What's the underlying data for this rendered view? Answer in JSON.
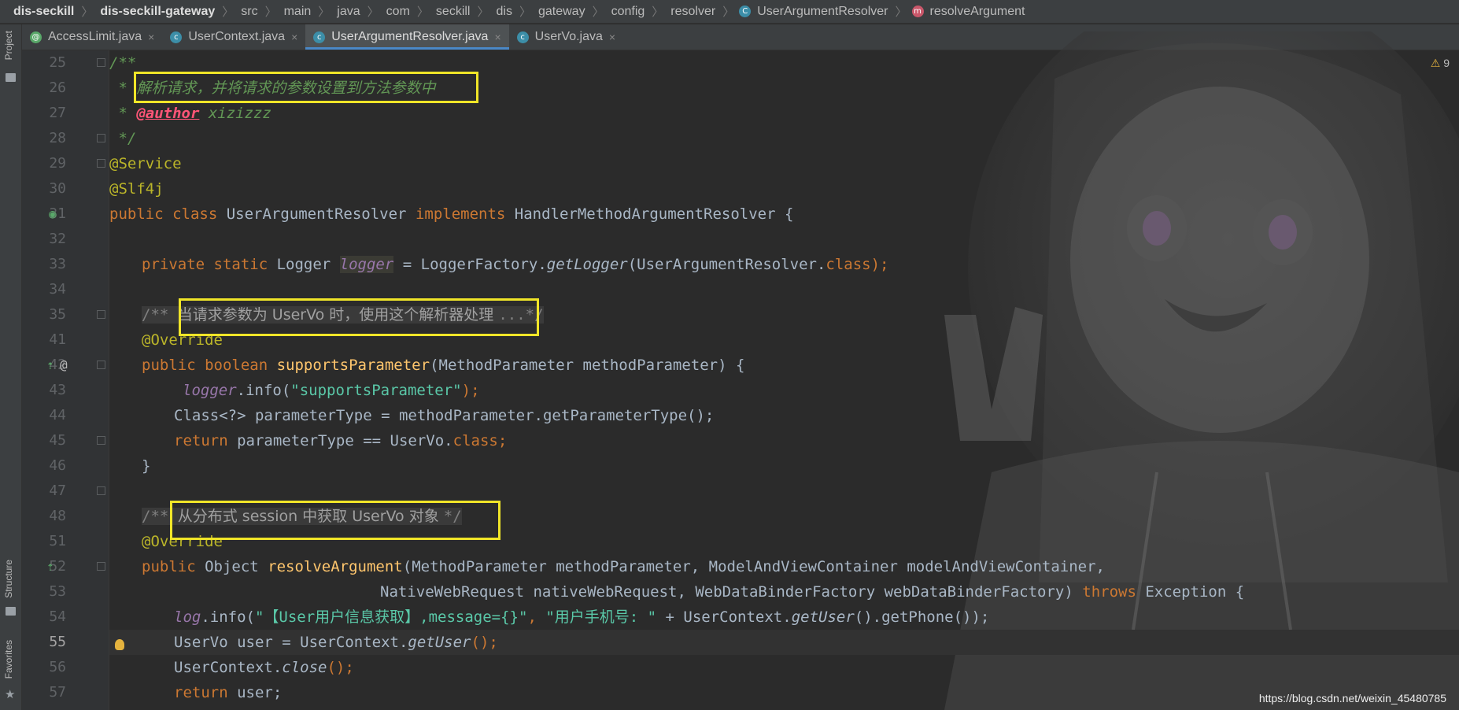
{
  "breadcrumb": {
    "items": [
      "dis-seckill",
      "dis-seckill-gateway",
      "src",
      "main",
      "java",
      "com",
      "seckill",
      "dis",
      "gateway",
      "config",
      "resolver",
      "UserArgumentResolver",
      "resolveArgument"
    ],
    "class_badge": "C",
    "method_badge": "m"
  },
  "tabs": [
    {
      "label": "AccessLimit.java",
      "icon": "annotation-icon",
      "close": "×"
    },
    {
      "label": "UserContext.java",
      "icon": "class-icon",
      "close": "×"
    },
    {
      "label": "UserArgumentResolver.java",
      "icon": "class-icon",
      "close": "×",
      "active": true
    },
    {
      "label": "UserVo.java",
      "icon": "class-icon",
      "close": "×"
    }
  ],
  "toolstrip": {
    "project": "Project",
    "structure": "Structure",
    "favorites": "Favorites"
  },
  "editor": {
    "warning_count": "9",
    "line_numbers": [
      "25",
      "26",
      "27",
      "28",
      "29",
      "30",
      "31",
      "32",
      "33",
      "34",
      "35",
      "41",
      "42",
      "43",
      "44",
      "45",
      "46",
      "47",
      "48",
      "51",
      "52",
      "53",
      "54",
      "55",
      "56",
      "57"
    ],
    "current_line": "55",
    "gutter_at": "@",
    "code": {
      "l25": "/**",
      "l26_star": " * ",
      "l26_text": "解析请求，并将请求的参数设置到方法参数中",
      "l27_star": " * ",
      "l27_tag": "@author",
      "l27_text": " xizizzz",
      "l28": " */",
      "l29": "@Service",
      "l30": "@Slf4j",
      "l31_kw": "public class ",
      "l31_name": "UserArgumentResolver ",
      "l31_impl": "implements ",
      "l31_rest": "HandlerMethodArgumentResolver {",
      "l33_kw": "private static ",
      "l33_type": "Logger ",
      "l33_field": "logger",
      "l33_eq": " = LoggerFactory.",
      "l33_call": "getLogger",
      "l33_arg": "(UserArgumentResolver.",
      "l33_class": "class",
      "l33_end": ");",
      "l35_open": "/** ",
      "l35_text": "当请求参数为 UserVo 时，使用这个解析器处理 ",
      "l35_end": "...*/",
      "l41": "@Override",
      "l42_kw": "public boolean ",
      "l42_fn": "supportsParameter",
      "l42_rest": "(MethodParameter methodParameter) {",
      "l43_field": "logger",
      "l43_mid": ".info(",
      "l43_str": "\"supportsParameter\"",
      "l43_end": ");",
      "l44": "Class<?> parameterType = methodParameter.getParameterType();",
      "l44_semi": ";",
      "l45_kw": "return ",
      "l45_mid": "parameterType == UserVo.",
      "l45_class": "class",
      "l45_end": ";",
      "l46": "}",
      "l48_open": "/** ",
      "l48_text": "从分布式 session 中获取 UserVo 对象 ",
      "l48_end": "*/",
      "l51": "@Override",
      "l52_kw": "public ",
      "l52_type": "Object ",
      "l52_fn": "resolveArgument",
      "l52_rest": "(MethodParameter methodParameter, ModelAndViewContainer modelAndViewContainer,",
      "l53_rest": "NativeWebRequest nativeWebRequest, WebDataBinderFactory webDataBinderFactory) ",
      "l53_kw": "throws ",
      "l53_end": "Exception {",
      "l54_field": "log",
      "l54_mid": ".info(",
      "l54_str": "\"【User用户信息获取】,message={}\"",
      "l54_comma": ", ",
      "l54_str2": "\"用户手机号: \"",
      "l54_rest": " + UserContext.",
      "l54_call": "getUser",
      "l54_end": "().getPhone());",
      "l55_pre": "UserVo user = UserContext.",
      "l55_call": "getUser",
      "l55_end": "();",
      "l56_pre": "UserContext.",
      "l56_call": "close",
      "l56_end": "();",
      "l57_kw": "return ",
      "l57_rest": "user;"
    }
  },
  "watermark": "https://blog.csdn.net/weixin_45480785",
  "colors": {
    "keyword": "#cc7832",
    "annotation": "#bbb529",
    "string": "#6a8759",
    "field": "#9876aa",
    "method": "#ffc66d",
    "doc_comment": "#629755",
    "highlight_box": "#f0e528"
  }
}
